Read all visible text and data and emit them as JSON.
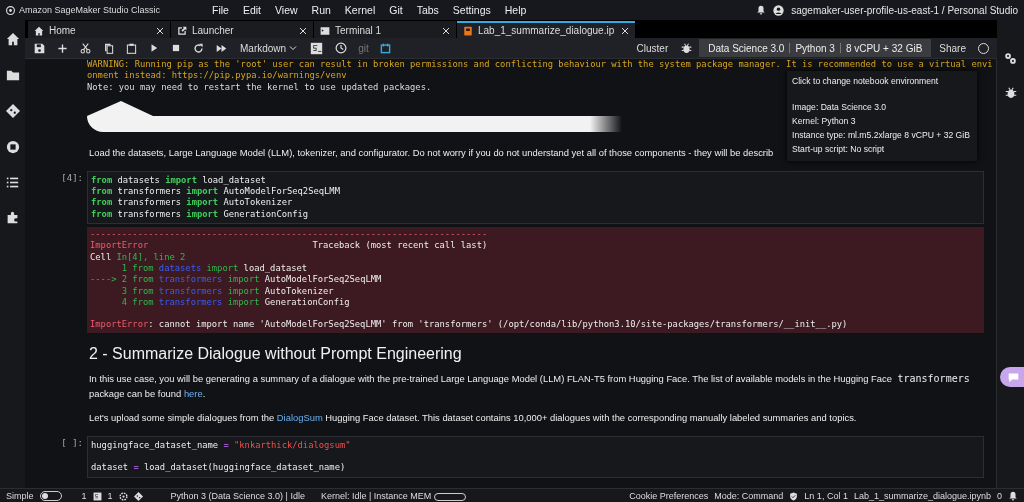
{
  "app_bar": {
    "title": "Amazon SageMaker Studio Classic",
    "menu": [
      "File",
      "Edit",
      "View",
      "Run",
      "Kernel",
      "Git",
      "Tabs",
      "Settings",
      "Help"
    ],
    "user": "sagemaker-user-profile-us-east-1 / Personal Studio"
  },
  "tabs": [
    {
      "label": "Home",
      "kind": "home",
      "selected": false
    },
    {
      "label": "Launcher",
      "kind": "launcher",
      "selected": false
    },
    {
      "label": "Terminal 1",
      "kind": "terminal",
      "selected": false
    },
    {
      "label": "Lab_1_summarize_dialogue.ip",
      "kind": "notebook",
      "selected": true
    }
  ],
  "toolbar": {
    "cell_type": "Markdown",
    "git_label": "git",
    "cluster": "Cluster",
    "environment": [
      "Data Science 3.0",
      "Python 3",
      "8 vCPU + 32 GiB"
    ],
    "share": "Share"
  },
  "tooltip": {
    "title": "Click to change notebook environment",
    "lines": [
      "Image: Data Science 3.0",
      "Kernel: Python 3",
      "Instance type: ml.m5.2xlarge 8 vCPU + 32 GiB",
      "Start-up script: No script"
    ]
  },
  "cells": [
    {
      "kind": "output",
      "lines": [
        {
          "kind": "warning",
          "text": "WARNING: Running pip as the 'root' user can result in broken permissions and conflicting behaviour with the system package manager. It is recommended to use a virtual envi"
        },
        {
          "kind": "warning",
          "text": "onment instead: https://pip.pypa.io/warnings/venv"
        },
        {
          "kind": "plain",
          "text": "Note: you may need to restart the kernel to use updated packages."
        }
      ]
    },
    {
      "kind": "image"
    },
    {
      "kind": "markdown",
      "paragraphs": [
        [
          {
            "kind": "text",
            "text": "Load the datasets, Large Language Model (LLM), tokenizer, and configurator. Do not worry if you do not understand yet all of those components - they will be describ"
          }
        ]
      ]
    },
    {
      "kind": "code",
      "prompt": "[4]:",
      "lines": [
        {
          "kind": "line",
          "segments": [
            {
              "kind": "kw",
              "text": "from"
            },
            {
              "kind": "plain",
              "text": " datasets "
            },
            {
              "kind": "kw",
              "text": "import"
            },
            {
              "kind": "plain",
              "text": " load_dataset"
            }
          ]
        },
        {
          "kind": "line",
          "segments": [
            {
              "kind": "kw",
              "text": "from"
            },
            {
              "kind": "plain",
              "text": " transformers "
            },
            {
              "kind": "kw",
              "text": "import"
            },
            {
              "kind": "plain",
              "text": " AutoModelForSeq2SeqLMM"
            }
          ]
        },
        {
          "kind": "line",
          "segments": [
            {
              "kind": "kw",
              "text": "from"
            },
            {
              "kind": "plain",
              "text": " transformers "
            },
            {
              "kind": "kw",
              "text": "import"
            },
            {
              "kind": "plain",
              "text": " AutoTokenizer"
            }
          ]
        },
        {
          "kind": "line",
          "segments": [
            {
              "kind": "kw",
              "text": "from"
            },
            {
              "kind": "plain",
              "text": " transformers "
            },
            {
              "kind": "kw",
              "text": "import"
            },
            {
              "kind": "plain",
              "text": " GenerationConfig"
            }
          ]
        }
      ],
      "error": [
        {
          "kind": "line",
          "segments": [
            {
              "kind": "err",
              "text": "---------------------------------------------------------------------------"
            }
          ]
        },
        {
          "kind": "line",
          "segments": [
            {
              "kind": "err",
              "text": "ImportError"
            },
            {
              "kind": "plain",
              "text": "                               Traceback (most recent call last)"
            }
          ]
        },
        {
          "kind": "line",
          "segments": [
            {
              "kind": "plain",
              "text": "Cell "
            },
            {
              "kind": "num",
              "text": "In[4], line 2"
            }
          ]
        },
        {
          "kind": "line",
          "segments": [
            {
              "kind": "num",
              "text": "      1 from"
            },
            {
              "kind": "name",
              "text": " datasets"
            },
            {
              "kind": "num",
              "text": " import"
            },
            {
              "kind": "plain",
              "text": " load_dataset"
            }
          ]
        },
        {
          "kind": "line",
          "segments": [
            {
              "kind": "num",
              "text": "----> 2 from"
            },
            {
              "kind": "name",
              "text": " transformers"
            },
            {
              "kind": "num",
              "text": " import"
            },
            {
              "kind": "plain",
              "text": " AutoModelForSeq2SeqLMM"
            }
          ]
        },
        {
          "kind": "line",
          "segments": [
            {
              "kind": "num",
              "text": "      3 from"
            },
            {
              "kind": "name",
              "text": " transformers"
            },
            {
              "kind": "num",
              "text": " import"
            },
            {
              "kind": "plain",
              "text": " AutoTokenizer"
            }
          ]
        },
        {
          "kind": "line",
          "segments": [
            {
              "kind": "num",
              "text": "      4 from"
            },
            {
              "kind": "name",
              "text": " transformers"
            },
            {
              "kind": "num",
              "text": " import"
            },
            {
              "kind": "plain",
              "text": " GenerationConfig"
            }
          ]
        },
        {
          "kind": "after_blank",
          "segments": [
            {
              "kind": "err",
              "text": "ImportError"
            },
            {
              "kind": "plain",
              "text": ": cannot import name 'AutoModelForSeq2SeqLMM' from 'transformers' (/opt/conda/lib/python3.10/site-packages/transformers/__init__.py)"
            }
          ]
        }
      ]
    },
    {
      "kind": "heading",
      "text": "2 - Summarize Dialogue without Prompt Engineering"
    },
    {
      "kind": "markdown",
      "paragraphs": [
        [
          {
            "kind": "text",
            "text": "In this use case, you will be generating a summary of a dialogue with the pre-trained Large Language Model (LLM) FLAN-T5 from Hugging Face. The list of available models in the Hugging Face "
          },
          {
            "kind": "code",
            "text": "transformers"
          },
          {
            "kind": "text",
            "text": " package can be found "
          },
          {
            "kind": "link",
            "text": "here"
          },
          {
            "kind": "text",
            "text": "."
          }
        ],
        [
          {
            "kind": "text",
            "text": "Let's upload some simple dialogues from the "
          },
          {
            "kind": "link",
            "text": "DialogSum"
          },
          {
            "kind": "text",
            "text": " Hugging Face dataset. This dataset contains 10,000+ dialogues with the corresponding manually labeled summaries and topics."
          }
        ]
      ]
    },
    {
      "kind": "code",
      "prompt": "[ ]:",
      "lines": [
        {
          "kind": "line",
          "segments": [
            {
              "kind": "plain",
              "text": "huggingface_dataset_name "
            },
            {
              "kind": "op",
              "text": "="
            },
            {
              "kind": "str",
              "text": " \"knkarthick/dialogsum\""
            }
          ]
        },
        {
          "kind": "after_blank",
          "segments": [
            {
              "kind": "plain",
              "text": "dataset "
            },
            {
              "kind": "op",
              "text": "="
            },
            {
              "kind": "plain",
              "text": " load_dataset(huggingface_dataset_name)"
            }
          ]
        }
      ]
    }
  ],
  "status_bar": {
    "mode_toggle": {
      "label": "Simple",
      "on": false
    },
    "terminals": "1",
    "kernels": "1",
    "kernel_status": "Python 3 (Data Science 3.0) | Idle",
    "instance": "Kernel: Idle | Instance MEM",
    "cookies": "Cookie Preferences",
    "mode_label": "Mode: Command",
    "position": "Ln 1, Col 1",
    "file": "Lab_1_summarize_dialogue.ipynb",
    "notifications": "0"
  }
}
